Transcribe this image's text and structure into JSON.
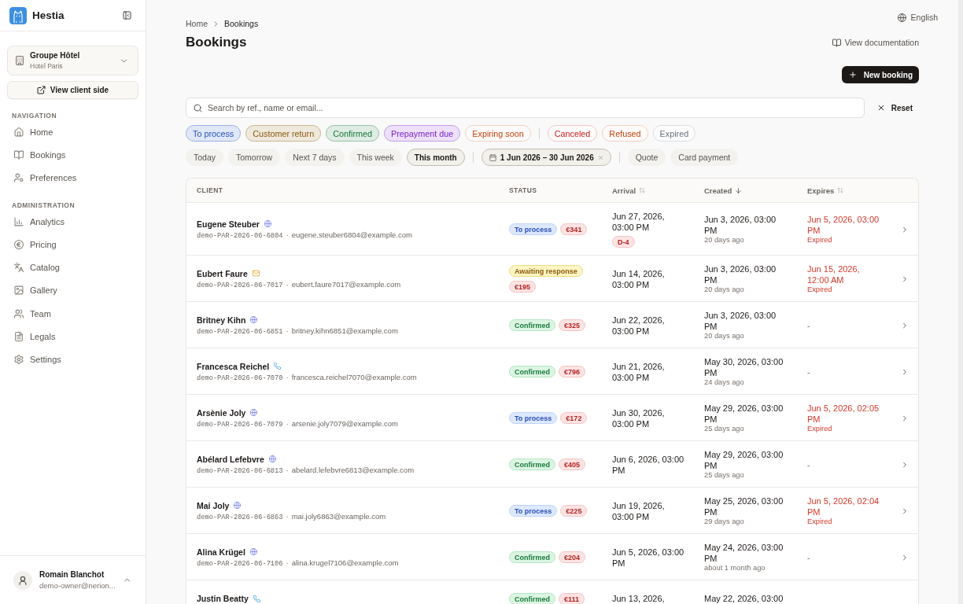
{
  "sidebar": {
    "brand": "Hestia",
    "organization": {
      "name": "Groupe Hôtel",
      "property": "Hotel Paris"
    },
    "client_side_button": "View client side",
    "sections": [
      {
        "title": "NAVIGATION",
        "items": [
          {
            "label": "Home"
          },
          {
            "label": "Bookings"
          },
          {
            "label": "Preferences"
          }
        ]
      },
      {
        "title": "ADMINISTRATION",
        "items": [
          {
            "label": "Analytics"
          },
          {
            "label": "Pricing"
          },
          {
            "label": "Catalog"
          },
          {
            "label": "Gallery"
          },
          {
            "label": "Team"
          },
          {
            "label": "Legals"
          },
          {
            "label": "Settings"
          }
        ]
      }
    ],
    "user": {
      "name": "Romain Blanchot",
      "email": "demo-owner@nerion..."
    }
  },
  "header": {
    "language": "English",
    "breadcrumb": [
      "Home",
      "Bookings"
    ],
    "title": "Bookings",
    "docs_link": "View documentation",
    "primary_button": "New booking"
  },
  "search": {
    "placeholder": "Search by ref., name or email..."
  },
  "reset_button": "Reset",
  "status_filter_groups": [
    {
      "items": [
        {
          "label": "To process",
          "color": "#2550c0",
          "selected": true
        },
        {
          "label": "Customer return",
          "color": "#8a5a0b",
          "selected": true
        },
        {
          "label": "Confirmed",
          "color": "#17793b",
          "selected": true
        },
        {
          "label": "Prepayment due",
          "color": "#7e22ce",
          "selected": true
        },
        {
          "label": "Expiring soon",
          "color": "#c2410c",
          "selected": false
        }
      ]
    },
    {
      "items": [
        {
          "label": "Canceled",
          "color": "#c81e1e",
          "selected": false
        },
        {
          "label": "Refused",
          "color": "#c2410c",
          "selected": false
        },
        {
          "label": "Expired",
          "color": "#6b7280",
          "selected": false
        }
      ]
    }
  ],
  "quick_filters": {
    "periods": [
      {
        "label": "Today",
        "selected": false
      },
      {
        "label": "Tomorrow",
        "selected": false
      },
      {
        "label": "Next 7 days",
        "selected": false
      },
      {
        "label": "This week",
        "selected": false
      },
      {
        "label": "This month",
        "selected": true
      }
    ],
    "date_range": "1 Jun 2026 – 30 Jun 2026",
    "payment_types": [
      {
        "label": "Quote",
        "selected": false
      },
      {
        "label": "Card payment",
        "selected": false
      }
    ]
  },
  "table": {
    "columns": [
      {
        "label": "CLIENT"
      },
      {
        "label": "STATUS"
      },
      {
        "label": "Arrival",
        "sorted": false
      },
      {
        "label": "Created",
        "sorted": true
      },
      {
        "label": "Expires",
        "sorted": false
      }
    ],
    "rows": [
      {
        "client": "Eugene Steuber",
        "channel": {
          "kind": "web"
        },
        "ref": "demo-PAR-2026-06-6804",
        "separator": "·",
        "email": "eugene.steuber6804@example.com",
        "status": [
          {
            "label": "To process",
            "kind": "process"
          },
          {
            "label": "€341",
            "kind": "amount"
          }
        ],
        "arrival": "Jun 27, 2026, 03:00 PM",
        "countdown": "D-4",
        "created": "Jun 3, 2026, 03:00 PM",
        "created_ago": "20 days ago",
        "expires": "Jun 5, 2026, 03:00 PM",
        "expires_note": "Expired",
        "expired": true
      },
      {
        "client": "Eubert Faure",
        "channel": {
          "kind": "email"
        },
        "ref": "demo-PAR-2026-06-7017",
        "separator": "·",
        "email": "eubert.faure7017@example.com",
        "status": [
          {
            "label": "Awaiting response",
            "kind": "awaiting"
          },
          {
            "label": "€195",
            "kind": "amount"
          }
        ],
        "arrival": "Jun 14, 2026, 03:00 PM",
        "created": "Jun 3, 2026, 03:00 PM",
        "created_ago": "20 days ago",
        "expires": "Jun 15, 2026, 12:00 AM",
        "expires_note": "Expired",
        "expired": true
      },
      {
        "client": "Britney Kihn",
        "channel": {
          "kind": "web"
        },
        "ref": "demo-PAR-2026-06-6851",
        "separator": "·",
        "email": "britney.kihn6851@example.com",
        "status": [
          {
            "label": "Confirmed",
            "kind": "confirmed"
          },
          {
            "label": "€325",
            "kind": "amount"
          }
        ],
        "arrival": "Jun 22, 2026, 03:00 PM",
        "created": "Jun 3, 2026, 03:00 PM",
        "created_ago": "20 days ago",
        "expires": "-",
        "expired": false
      },
      {
        "client": "Francesca Reichel",
        "channel": {
          "kind": "phone"
        },
        "ref": "demo-PAR-2026-06-7070",
        "separator": "·",
        "email": "francesca.reichel7070@example.com",
        "status": [
          {
            "label": "Confirmed",
            "kind": "confirmed"
          },
          {
            "label": "€796",
            "kind": "amount"
          }
        ],
        "arrival": "Jun 21, 2026, 03:00 PM",
        "created": "May 30, 2026, 03:00 PM",
        "created_ago": "24 days ago",
        "expires": "-",
        "expired": false
      },
      {
        "client": "Arsènie Joly",
        "channel": {
          "kind": "web"
        },
        "ref": "demo-PAR-2026-06-7079",
        "separator": "·",
        "email": "arsenie.joly7079@example.com",
        "status": [
          {
            "label": "To process",
            "kind": "process"
          },
          {
            "label": "€172",
            "kind": "amount"
          }
        ],
        "arrival": "Jun 30, 2026, 03:00 PM",
        "created": "May 29, 2026, 03:00 PM",
        "created_ago": "25 days ago",
        "expires": "Jun 5, 2026, 02:05 PM",
        "expires_note": "Expired",
        "expired": true
      },
      {
        "client": "Abélard Lefebvre",
        "channel": {
          "kind": "web"
        },
        "ref": "demo-PAR-2026-06-6813",
        "separator": "·",
        "email": "abelard.lefebvre6813@example.com",
        "status": [
          {
            "label": "Confirmed",
            "kind": "confirmed"
          },
          {
            "label": "€405",
            "kind": "amount"
          }
        ],
        "arrival": "Jun 6, 2026, 03:00 PM",
        "created": "May 29, 2026, 03:00 PM",
        "created_ago": "25 days ago",
        "expires": "-",
        "expired": false
      },
      {
        "client": "Mai Joly",
        "channel": {
          "kind": "web"
        },
        "ref": "demo-PAR-2026-06-6863",
        "separator": "·",
        "email": "mai.joly6863@example.com",
        "status": [
          {
            "label": "To process",
            "kind": "process"
          },
          {
            "label": "€225",
            "kind": "amount"
          }
        ],
        "arrival": "Jun 19, 2026, 03:00 PM",
        "created": "May 25, 2026, 03:00 PM",
        "created_ago": "29 days ago",
        "expires": "Jun 5, 2026, 02:04 PM",
        "expires_note": "Expired",
        "expired": true
      },
      {
        "client": "Alina Krügel",
        "channel": {
          "kind": "web"
        },
        "ref": "demo-PAR-2026-06-7106",
        "separator": "·",
        "email": "alina.krugel7106@example.com",
        "status": [
          {
            "label": "Confirmed",
            "kind": "confirmed"
          },
          {
            "label": "€204",
            "kind": "amount"
          }
        ],
        "arrival": "Jun 5, 2026, 03:00 PM",
        "created": "May 24, 2026, 03:00 PM",
        "created_ago": "about 1 month ago",
        "expires": "-",
        "expired": false
      },
      {
        "client": "Justin Beatty",
        "channel": {
          "kind": "phone"
        },
        "status": [
          {
            "label": "Confirmed",
            "kind": "confirmed"
          },
          {
            "label": "€111",
            "kind": "amount"
          }
        ],
        "arrival": "Jun 13, 2026,",
        "created": "May 22, 2026, 03:00"
      }
    ]
  }
}
